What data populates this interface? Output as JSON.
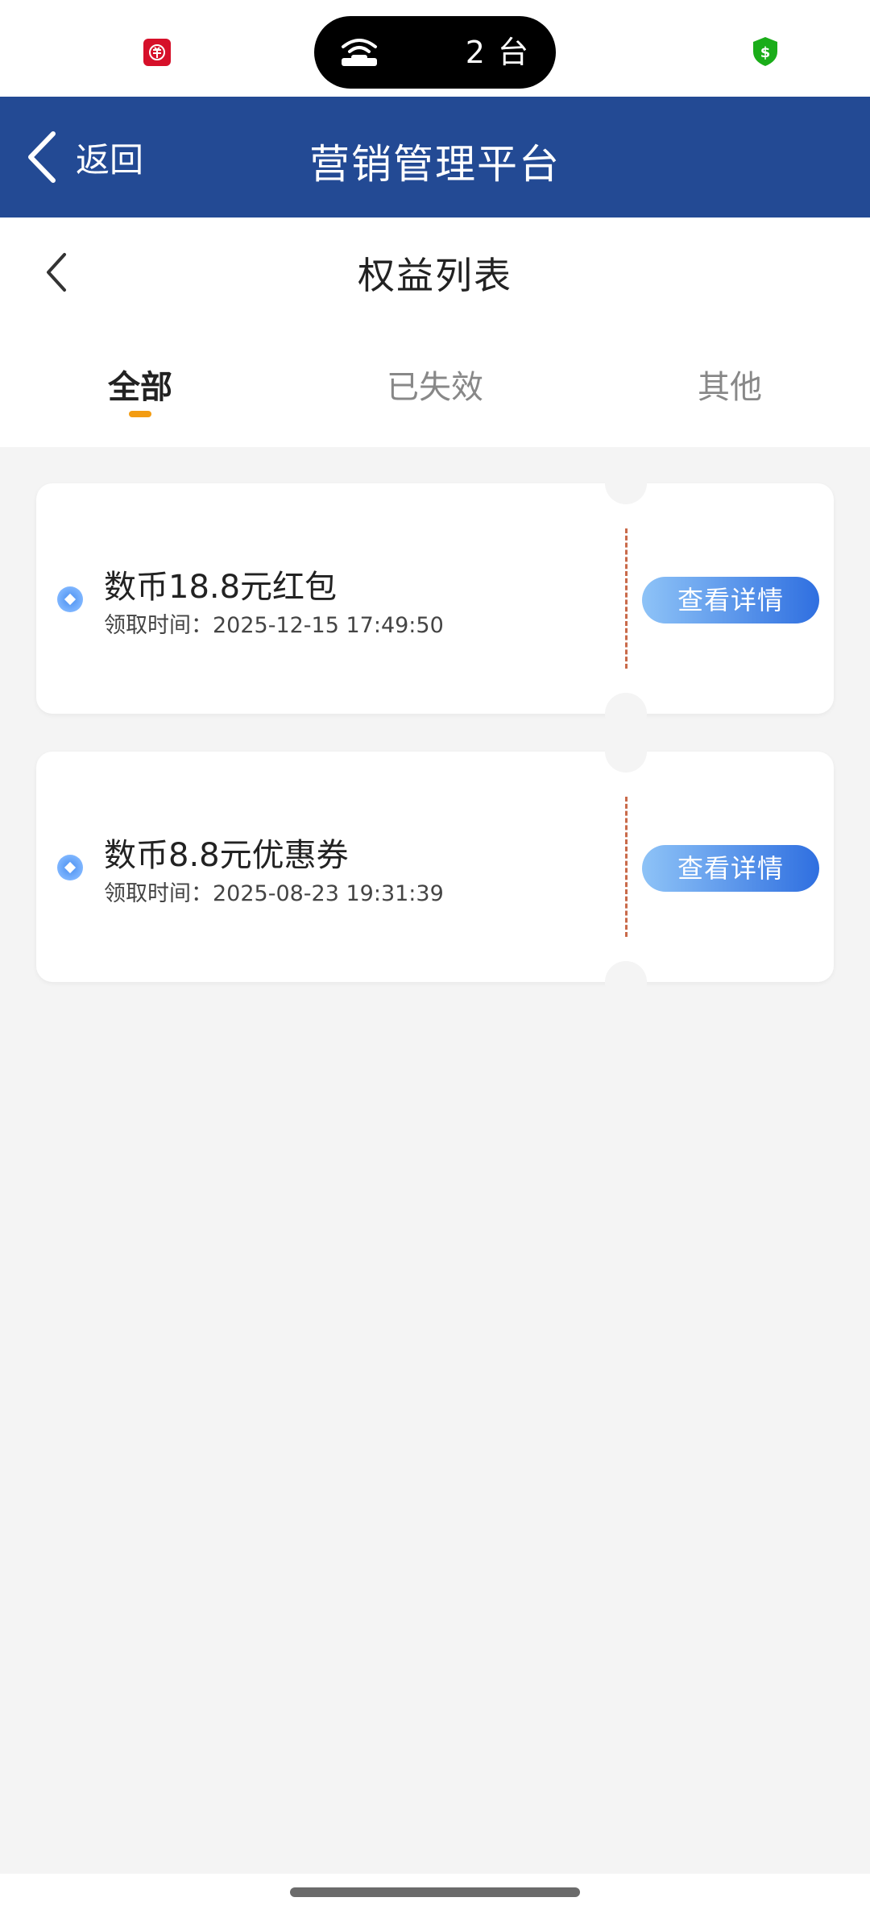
{
  "status_bar": {
    "pill_text": "2 台",
    "left_icon": "digital-rmb-icon",
    "wifi_icon": "wifi-bed-icon",
    "right_icon": "security-shield-dollar-icon",
    "colors": {
      "left_icon": "#d6102a",
      "right_icon": "#1aad19"
    }
  },
  "app_header": {
    "back_label": "返回",
    "title": "营销管理平台",
    "background": "#234a94"
  },
  "page": {
    "title": "权益列表",
    "tabs": [
      {
        "label": "全部",
        "active": true
      },
      {
        "label": "已失效",
        "active": false
      },
      {
        "label": "其他",
        "active": false
      }
    ],
    "indicator_color": "#f39c12"
  },
  "benefits": [
    {
      "title": "数币18.8元红包",
      "time": "领取时间：2025-12-15 17:49:50",
      "action": "查看详情"
    },
    {
      "title": "数币8.8元优惠券",
      "time": "领取时间：2025-08-23 19:31:39",
      "action": "查看详情"
    }
  ]
}
